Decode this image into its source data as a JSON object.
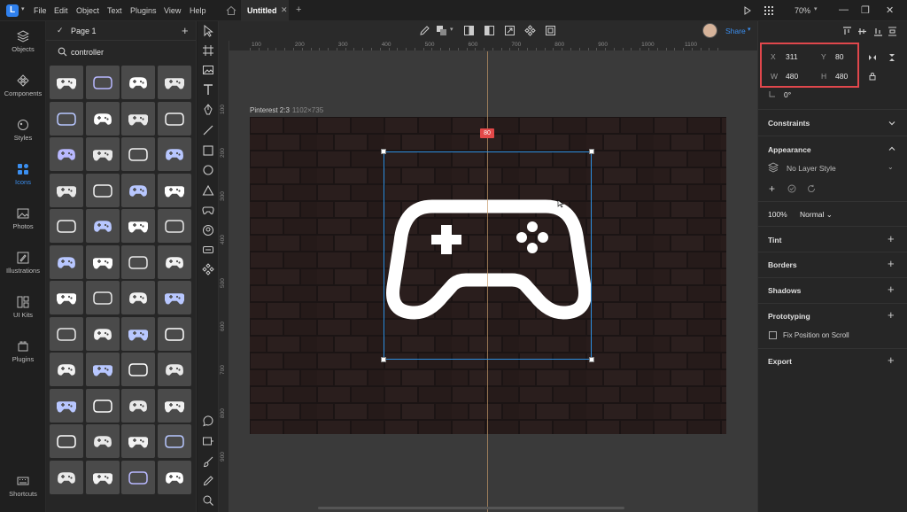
{
  "titlebar": {
    "logo": "L",
    "menu": [
      "File",
      "Edit",
      "Object",
      "Text",
      "Plugins",
      "View",
      "Help"
    ],
    "document_tab": "Untitled",
    "zoom": "70%",
    "icons": [
      "home-icon",
      "play-icon",
      "grid-icon",
      "minimize-icon",
      "maximize-icon",
      "close-icon"
    ]
  },
  "rail": {
    "items": [
      {
        "label": "Objects",
        "icon": "layers-icon"
      },
      {
        "label": "Components",
        "icon": "components-icon"
      },
      {
        "label": "Styles",
        "icon": "styles-icon"
      },
      {
        "label": "Icons",
        "icon": "icons-icon",
        "active": true
      },
      {
        "label": "Photos",
        "icon": "photos-icon"
      },
      {
        "label": "Illustrations",
        "icon": "illustrations-icon"
      },
      {
        "label": "UI Kits",
        "icon": "ui-kits-icon"
      },
      {
        "label": "Plugins",
        "icon": "plugins-icon"
      }
    ],
    "shortcuts": "Shortcuts"
  },
  "assets": {
    "page": "Page 1",
    "search_value": "controller"
  },
  "canvas": {
    "artboard_name": "Pinterest 2:3",
    "artboard_size": "1102×735",
    "y_badge": "80",
    "ruler_top": [
      "100",
      "200",
      "300",
      "400",
      "500",
      "600",
      "700",
      "800",
      "900",
      "1000",
      "1100"
    ],
    "ruler_left": [
      "100",
      "200",
      "300",
      "400",
      "500",
      "600",
      "700",
      "800",
      "900"
    ],
    "share_label": "Share"
  },
  "inspector": {
    "x_label": "X",
    "x_value": "311",
    "y_label": "Y",
    "y_value": "80",
    "w_label": "W",
    "w_value": "480",
    "h_label": "H",
    "h_value": "480",
    "rotation": "0°",
    "sections": {
      "constraints": "Constraints",
      "appearance": "Appearance",
      "tint": "Tint",
      "borders": "Borders",
      "shadows": "Shadows",
      "prototyping": "Prototyping",
      "export": "Export"
    },
    "layer_style": "No Layer Style",
    "opacity": "100%",
    "blend_mode": "Normal",
    "fix_position": "Fix Position on Scroll",
    "highlight_color": "#e0474c"
  }
}
